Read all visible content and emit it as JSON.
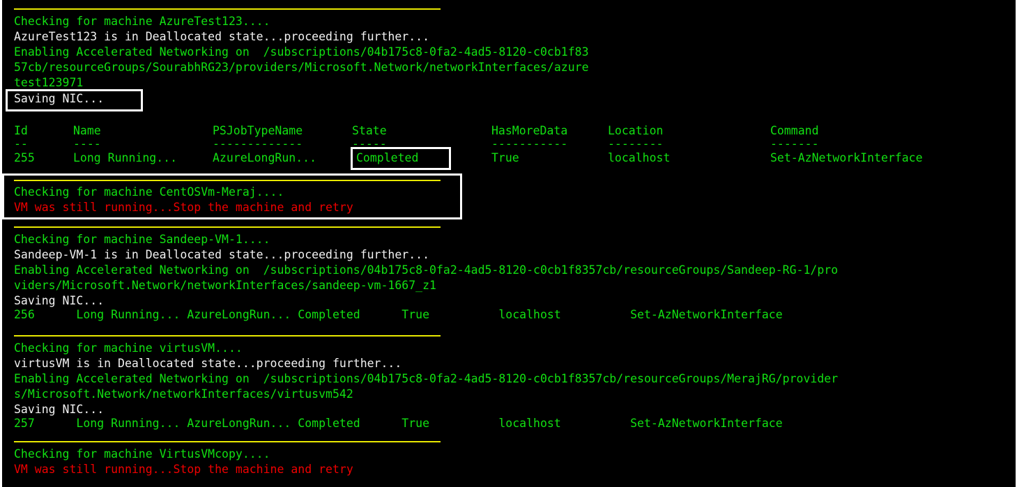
{
  "console": {
    "background_color": "#000000",
    "text_color_green": "#12e012",
    "text_color_white": "#f2f2f2",
    "text_color_red": "#ee0000",
    "separator_color": "#e8e800",
    "highlight_box_color": "#ffffff"
  },
  "blocks": {
    "azuretest123": {
      "checking": "Checking for machine AzureTest123....",
      "state": "AzureTest123 is in Deallocated state...proceeding further...",
      "enabling_1": "Enabling Accelerated Networking on  /subscriptions/04b175c8-0fa2-4ad5-8120-c0cb1f83",
      "enabling_2": "57cb/resourceGroups/SourabhRG23/providers/Microsoft.Network/networkInterfaces/azure",
      "enabling_3": "test123971",
      "saving": "Saving NIC..."
    },
    "job_table": {
      "headers": [
        "Id",
        "Name",
        "PSJobTypeName",
        "State",
        "HasMoreData",
        "Location",
        "Command"
      ],
      "dashes": [
        "--",
        "----",
        "-------------",
        "-----",
        "-----------",
        "--------",
        "-------"
      ],
      "row_255": {
        "id": "255",
        "name": "Long Running...",
        "ps_job_type_name": "AzureLongRun...",
        "state": "Completed",
        "has_more_data": "True",
        "location": "localhost",
        "command": "Set-AzNetworkInterface"
      }
    },
    "centosvm_meraj": {
      "checking": "Checking for machine CentOSVm-Meraj....",
      "error": "VM was still running...Stop the machine and retry"
    },
    "sandeep_vm_1": {
      "checking": "Checking for machine Sandeep-VM-1....",
      "state": "Sandeep-VM-1 is in Deallocated state...proceeding further...",
      "enabling_1": "Enabling Accelerated Networking on  /subscriptions/04b175c8-0fa2-4ad5-8120-c0cb1f8357cb/resourceGroups/Sandeep-RG-1/pro",
      "enabling_2": "viders/Microsoft.Network/networkInterfaces/sandeep-vm-1667_z1",
      "saving": "Saving NIC...",
      "row": "256      Long Running... AzureLongRun... Completed      True          localhost          Set-AzNetworkInterface"
    },
    "virtusvm": {
      "checking": "Checking for machine virtusVM....",
      "state": "virtusVM is in Deallocated state...proceeding further...",
      "enabling_1": "Enabling Accelerated Networking on  /subscriptions/04b175c8-0fa2-4ad5-8120-c0cb1f8357cb/resourceGroups/MerajRG/provider",
      "enabling_2": "s/Microsoft.Network/networkInterfaces/virtusvm542",
      "saving": "Saving NIC...",
      "row": "257      Long Running... AzureLongRun... Completed      True          localhost          Set-AzNetworkInterface"
    },
    "virtusvmcopy": {
      "checking": "Checking for machine VirtusVMcopy....",
      "error": "VM was still running...Stop the machine and retry"
    }
  }
}
